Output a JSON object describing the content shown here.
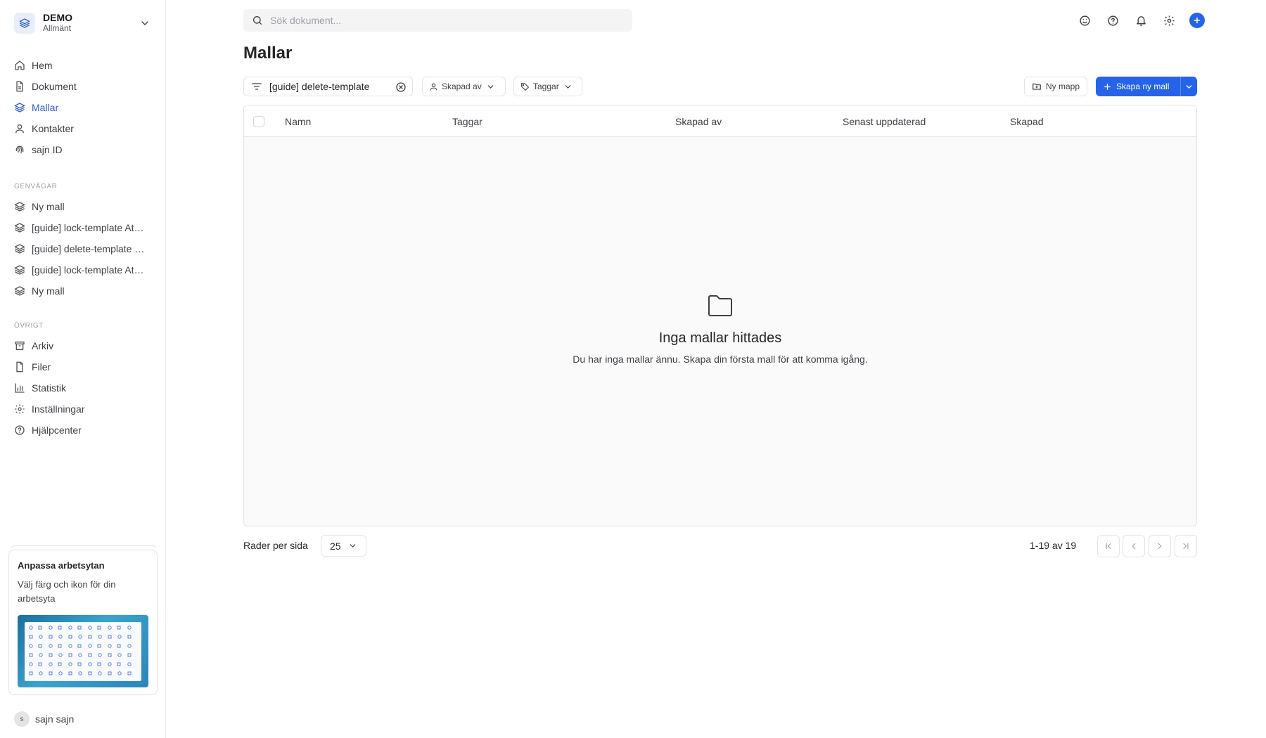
{
  "workspace": {
    "name": "DEMO",
    "subtitle": "Allmänt"
  },
  "nav": {
    "main": [
      {
        "label": "Hem",
        "icon": "home-icon"
      },
      {
        "label": "Dokument",
        "icon": "document-icon"
      },
      {
        "label": "Mallar",
        "icon": "layers-icon",
        "active": true
      },
      {
        "label": "Kontakter",
        "icon": "user-icon"
      },
      {
        "label": "sajn ID",
        "icon": "fingerprint-icon"
      }
    ],
    "shortcuts_label": "GENVÄGAR",
    "shortcuts": [
      {
        "label": "Ny mall",
        "icon": "layers-icon"
      },
      {
        "label": "[guide] lock-template At…",
        "icon": "layers-icon"
      },
      {
        "label": "[guide] delete-template …",
        "icon": "layers-icon"
      },
      {
        "label": "[guide] lock-template At…",
        "icon": "layers-icon"
      },
      {
        "label": "Ny mall",
        "icon": "layers-icon"
      }
    ],
    "other_label": "ÖVRIGT",
    "other": [
      {
        "label": "Arkiv",
        "icon": "archive-icon"
      },
      {
        "label": "Filer",
        "icon": "file-icon"
      },
      {
        "label": "Statistik",
        "icon": "chart-icon"
      },
      {
        "label": "Inställningar",
        "icon": "gear-icon"
      },
      {
        "label": "Hjälpcenter",
        "icon": "help-icon"
      }
    ]
  },
  "promo": {
    "title": "Anpassa arbetsytan",
    "text": "Välj färg och ikon för din arbetsyta"
  },
  "user": {
    "initial": "s",
    "name": "sajn sajn"
  },
  "search": {
    "placeholder": "Sök dokument...",
    "value": ""
  },
  "page": {
    "title": "Mallar"
  },
  "toolbar": {
    "filter_value": "[guide] delete-template",
    "created_by_label": "Skapad av",
    "tags_label": "Taggar",
    "new_folder_label": "Ny mapp",
    "create_label": "Skapa ny mall"
  },
  "table": {
    "columns": [
      "Namn",
      "Taggar",
      "Skapad av",
      "Senast uppdaterad",
      "Skapad"
    ],
    "empty_title": "Inga mallar hittades",
    "empty_text": "Du har inga mallar ännu. Skapa din första mall för att komma igång."
  },
  "pagination": {
    "rows_label": "Rader per sida",
    "rows_value": "25",
    "range": "1-19 av 19"
  },
  "colors": {
    "accent": "#2563eb",
    "active_nav": "#2f5bd9",
    "border": "#e4e4e7"
  }
}
